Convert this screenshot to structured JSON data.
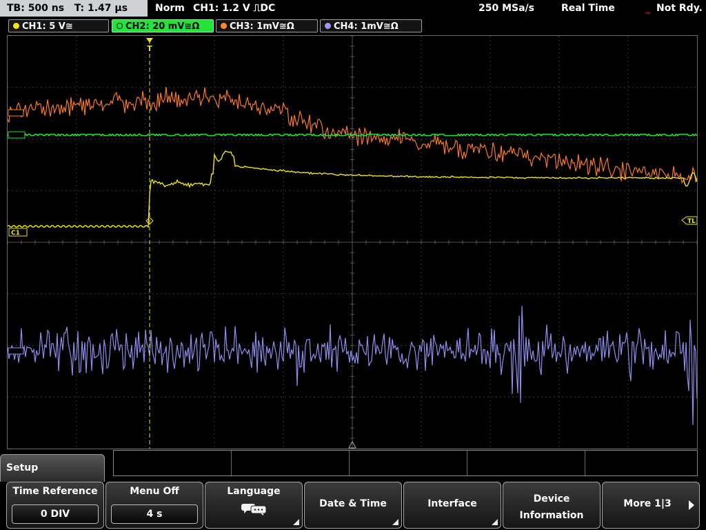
{
  "status": {
    "timebase": "TB: 500 ns",
    "trigger_time": "T: 1.47 µs",
    "trigger_mode": "Norm",
    "trigger_info": "CH1: 1.2 V ⎍DC",
    "sample_rate": "250 MSa/s",
    "acq_mode": "Real Time",
    "state": "Not Rdy."
  },
  "channels": [
    {
      "label": "CH1: 5 V≅",
      "color": "#f0e414"
    },
    {
      "label": "CH2: 20 mV≅Ω",
      "color": "#22e43a"
    },
    {
      "label": "CH3: 1mV≅Ω",
      "color": "#ff8a2a"
    },
    {
      "label": "CH4: 1mV≅Ω",
      "color": "#9a9af0"
    }
  ],
  "markers": {
    "ch1_ref": "C1",
    "trigger_level": "TL",
    "trigger_point": "T"
  },
  "menu": {
    "title": "Setup",
    "time_reference": {
      "label": "Time Reference",
      "value": "0 DIV"
    },
    "menu_off": {
      "label": "Menu Off",
      "value": "4 s"
    },
    "language": {
      "label": "Language",
      "icon": "speech-bubbles-icon"
    },
    "date_time": {
      "label": "Date & Time"
    },
    "interface": {
      "label": "Interface"
    },
    "device_info": {
      "line1": "Device",
      "line2": "Information"
    },
    "more": {
      "label": "More 1|3"
    }
  }
}
